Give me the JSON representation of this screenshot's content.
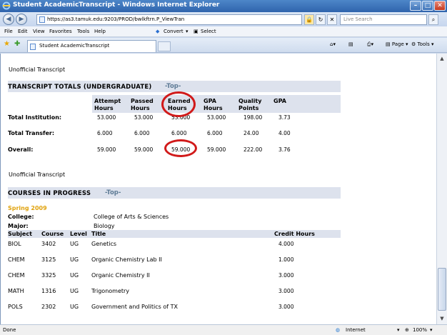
{
  "window": {
    "title": "Student AcademicTranscript - Windows Internet Explorer",
    "minimize_icon": "minimize-icon",
    "maximize_icon": "maximize-icon",
    "close_icon": "close-icon"
  },
  "address_bar": {
    "url": "https://as3.tamuk.edu:9203/PROD/bwlkftrn.P_ViewTran",
    "search_placeholder": "Live Search",
    "back_icon": "back-arrow-icon",
    "forward_icon": "forward-arrow-icon"
  },
  "menu": {
    "items": [
      "File",
      "Edit",
      "View",
      "Favorites",
      "Tools",
      "Help"
    ],
    "convert": "Convert",
    "select": "Select"
  },
  "tabs": {
    "active": "Student AcademicTranscript"
  },
  "toolbar": {
    "page": "Page",
    "tools": "Tools"
  },
  "transcript": {
    "unofficial_1": "Unofficial Transcript",
    "totals_title": "TRANSCRIPT TOTALS (UNDERGRADUATE)",
    "top_link": "-Top-",
    "columns": [
      [
        "Attempt",
        "Hours"
      ],
      [
        "Passed",
        "Hours"
      ],
      [
        "Earned",
        "Hours"
      ],
      [
        "GPA",
        "Hours"
      ],
      [
        "Quality",
        "Points"
      ],
      [
        "GPA",
        ""
      ]
    ],
    "rows": [
      {
        "label": "Total Institution:",
        "values": [
          "53.000",
          "53.000",
          "53.000",
          "53.000",
          "198.00",
          "3.73"
        ]
      },
      {
        "label": "Total Transfer:",
        "values": [
          "6.000",
          "6.000",
          "6.000",
          "6.000",
          "24.00",
          "4.00"
        ]
      },
      {
        "label": "Overall:",
        "values": [
          "59.000",
          "59.000",
          "59.000",
          "59.000",
          "222.00",
          "3.76"
        ]
      }
    ],
    "unofficial_2": "Unofficial Transcript",
    "courses_title": "COURSES IN PROGRESS",
    "courses_top_link": "-Top-",
    "term": "Spring 2009",
    "college_label": "College:",
    "college_value": "College of Arts & Sciences",
    "major_label": "Major:",
    "major_value": "Biology",
    "course_headers": [
      "Subject",
      "Course",
      "Level",
      "Title",
      "Credit Hours"
    ],
    "courses": [
      [
        "BIOL",
        "3402",
        "UG",
        "Genetics",
        "4.000"
      ],
      [
        "CHEM",
        "3125",
        "UG",
        "Organic Chemistry Lab II",
        "1.000"
      ],
      [
        "CHEM",
        "3325",
        "UG",
        "Organic Chemistry II",
        "3.000"
      ],
      [
        "MATH",
        "1316",
        "UG",
        "Trigonometry",
        "3.000"
      ],
      [
        "POLS",
        "2302",
        "UG",
        "Government and Politics of TX",
        "3.000"
      ]
    ]
  },
  "status": {
    "left": "Done",
    "zone": "Internet",
    "zoom": "100%"
  },
  "colors": {
    "annotation_circle": "#d11a1a",
    "term": "#e0a20c",
    "top_link": "#5f7c96",
    "band": "#dde2ed"
  }
}
